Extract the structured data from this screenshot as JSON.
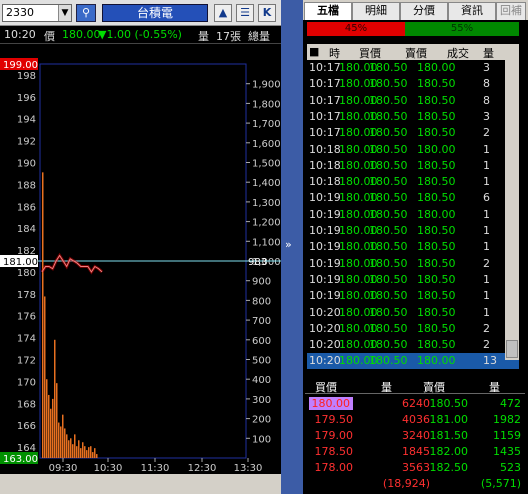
{
  "toolbar": {
    "symbol": "2330",
    "stock_name": "台積電",
    "buttons": [
      "▲",
      "☰",
      "K"
    ]
  },
  "info": {
    "time": "10:20",
    "price_label": "價",
    "price": "180.00",
    "change": "▼1.00 (-0.55%)",
    "volume_label": "量",
    "volume": "17張",
    "total_label": "總量"
  },
  "chart_data": {
    "type": "line",
    "ylim": [
      163,
      199
    ],
    "y_ticks": [
      "198",
      "196",
      "194",
      "192",
      "190",
      "188",
      "186",
      "184",
      "182",
      "180",
      "178",
      "176",
      "174",
      "172",
      "170",
      "168",
      "166",
      "164"
    ],
    "y_top_label": "199.00",
    "y_bottom_label": "163.00",
    "ref_price_label": "181.00",
    "vol_ticks": [
      "1,900",
      "1,800",
      "1,700",
      "1,600",
      "1,500",
      "1,400",
      "1,300",
      "1,200",
      "1,100",
      "1,000",
      "900",
      "800",
      "700",
      "600",
      "500",
      "400",
      "300",
      "200",
      "100"
    ],
    "vol_current_label": "983",
    "x_ticks": [
      "09:30",
      "10:30",
      "11:30",
      "12:30",
      "13:30"
    ],
    "price_series": [
      180.0,
      180.5,
      180.5,
      180.3,
      181.0,
      181.5,
      181.0,
      180.5,
      181.2,
      181.0,
      180.8,
      180.5,
      180.5,
      180.5,
      180.0,
      180.5,
      180.3,
      180.0
    ],
    "volume_series": [
      1450,
      820,
      400,
      320,
      250,
      300,
      600,
      380,
      180,
      160,
      220,
      150,
      120,
      90,
      100,
      70,
      120,
      60,
      90,
      50,
      80,
      60,
      40,
      55,
      60,
      30,
      50,
      20
    ]
  },
  "right": {
    "tabs": [
      "五檔",
      "明細",
      "分價",
      "資訊",
      "回補"
    ],
    "ratio_left": "45%",
    "ratio_right": "55%",
    "tick_headers": [
      "時",
      "買價",
      "賣價",
      "成交",
      "量"
    ],
    "ticks": [
      [
        "10:17",
        "180.00",
        "180.50",
        "180.00",
        "3"
      ],
      [
        "10:17",
        "180.00",
        "180.50",
        "180.50",
        "8"
      ],
      [
        "10:17",
        "180.00",
        "180.50",
        "180.50",
        "8"
      ],
      [
        "10:17",
        "180.00",
        "180.50",
        "180.50",
        "3"
      ],
      [
        "10:17",
        "180.00",
        "180.50",
        "180.50",
        "2"
      ],
      [
        "10:18",
        "180.00",
        "180.50",
        "180.00",
        "1"
      ],
      [
        "10:18",
        "180.00",
        "180.50",
        "180.50",
        "1"
      ],
      [
        "10:18",
        "180.00",
        "180.50",
        "180.50",
        "1"
      ],
      [
        "10:19",
        "180.00",
        "180.50",
        "180.50",
        "6"
      ],
      [
        "10:19",
        "180.00",
        "180.50",
        "180.00",
        "1"
      ],
      [
        "10:19",
        "180.00",
        "180.50",
        "180.50",
        "1"
      ],
      [
        "10:19",
        "180.00",
        "180.50",
        "180.50",
        "1"
      ],
      [
        "10:19",
        "180.00",
        "180.50",
        "180.50",
        "2"
      ],
      [
        "10:19",
        "180.00",
        "180.50",
        "180.50",
        "1"
      ],
      [
        "10:19",
        "180.00",
        "180.50",
        "180.50",
        "1"
      ],
      [
        "10:20",
        "180.00",
        "180.50",
        "180.50",
        "1"
      ],
      [
        "10:20",
        "180.00",
        "180.50",
        "180.50",
        "2"
      ],
      [
        "10:20",
        "180.00",
        "180.50",
        "180.50",
        "2"
      ],
      [
        "10:20",
        "180.00",
        "180.50",
        "180.00",
        "13"
      ]
    ],
    "ob_headers": [
      "買價",
      "量",
      "賣價",
      "量"
    ],
    "orderbook": [
      [
        "180.00",
        "6240",
        "180.50",
        "472"
      ],
      [
        "179.50",
        "4036",
        "181.00",
        "1982"
      ],
      [
        "179.00",
        "3240",
        "181.50",
        "1159"
      ],
      [
        "178.50",
        "1845",
        "182.00",
        "1435"
      ],
      [
        "178.00",
        "3563",
        "182.50",
        "523"
      ]
    ],
    "bid_total": "(18,924)",
    "ask_total": "(5,571)"
  },
  "colors": {
    "up": "#ff4040",
    "down": "#00dd00",
    "neutral": "#dddddd",
    "accent": "#2450b8"
  }
}
